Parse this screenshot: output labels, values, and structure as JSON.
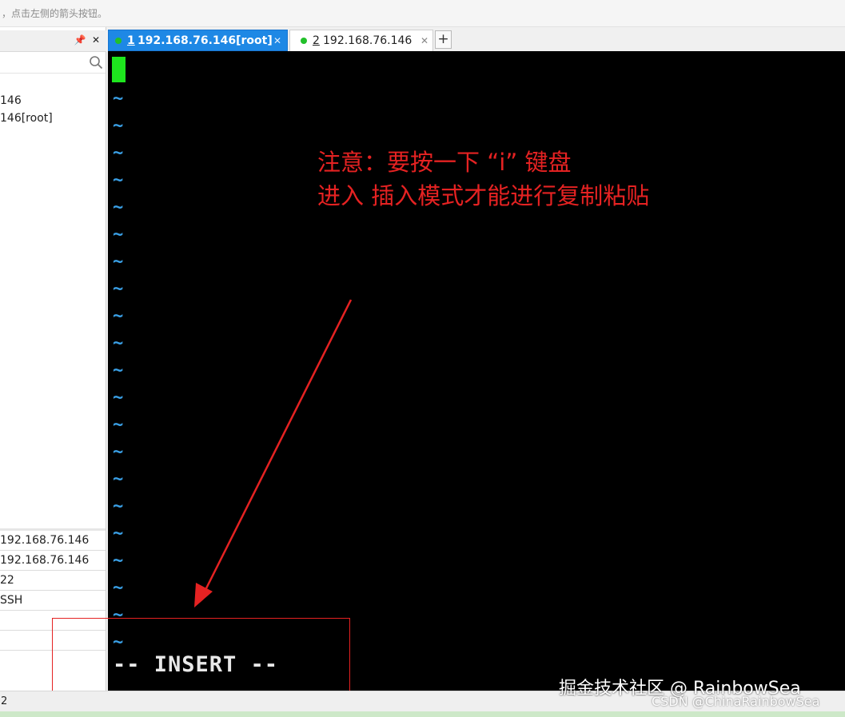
{
  "hint_bar": {
    "text": "，点击左侧的箭头按钮。"
  },
  "sessions_panel": {
    "tree": [
      "146",
      "146[root]"
    ],
    "properties": [
      "192.168.76.146",
      "192.168.76.146",
      "22",
      "SSH",
      "",
      ""
    ]
  },
  "tabs": [
    {
      "index": "1",
      "title": "192.168.76.146[root]",
      "active": true,
      "status_color": "#22c02a"
    },
    {
      "index": "2",
      "title": "192.168.76.146",
      "active": false,
      "status_color": "#22c02a"
    }
  ],
  "new_tab_label": "+",
  "terminal": {
    "tilde": "~",
    "tilde_count": 21,
    "mode_line": "-- INSERT --",
    "cursor_color": "#1ee61e",
    "tilde_color": "#3aa0e6"
  },
  "annotation": {
    "line1": "注意：要按一下 “i” 键盘",
    "line2": "进入 插入模式才能进行复制粘贴",
    "color": "#e52222"
  },
  "status_bar": {
    "text": "2"
  },
  "watermarks": {
    "juejin": "掘金技术社区 @ RainbowSea",
    "csdn": "CSDN @ChinaRainbowSea"
  }
}
